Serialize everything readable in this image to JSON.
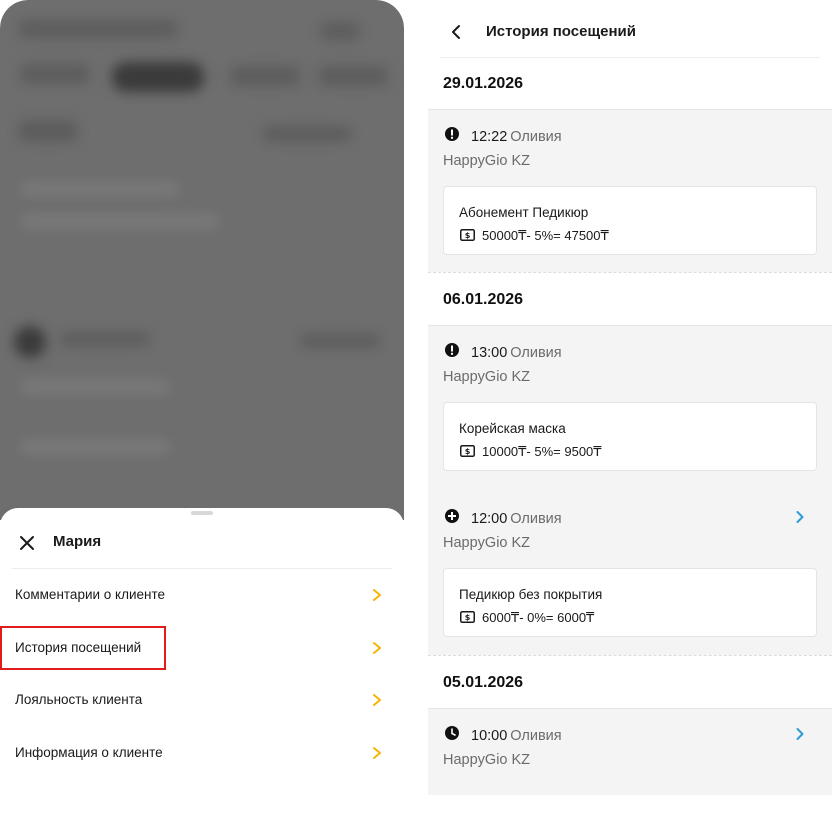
{
  "left": {
    "sheet": {
      "title": "Мария",
      "menu": [
        {
          "label": "Комментарии о клиенте"
        },
        {
          "label": "История посещений"
        },
        {
          "label": "Лояльность клиента"
        },
        {
          "label": "Информация о клиенте"
        }
      ]
    }
  },
  "right": {
    "title": "История посещений",
    "groups": [
      {
        "date": "29.01.2026",
        "visits": [
          {
            "status_icon": "alert-icon",
            "time": "12:22",
            "master": "Оливия",
            "salon": "HappyGio KZ",
            "service": "Абонемент Педикюр",
            "price": "50000₸- 5%= 47500₸"
          }
        ]
      },
      {
        "date": "06.01.2026",
        "visits": [
          {
            "status_icon": "alert-icon",
            "time": "13:00",
            "master": "Оливия",
            "salon": "HappyGio KZ",
            "service": "Корейская маска",
            "price": "10000₸- 5%= 9500₸"
          },
          {
            "status_icon": "plus-circle-icon",
            "time": "12:00",
            "master": "Оливия",
            "salon": "HappyGio KZ",
            "service": "Педикюр без покрытия",
            "price": "6000₸- 0%= 6000₸"
          }
        ]
      },
      {
        "date": "05.01.2026",
        "visits": [
          {
            "status_icon": "clock-icon",
            "time": "10:00",
            "master": "Оливия",
            "salon": "HappyGio KZ"
          }
        ]
      }
    ]
  },
  "colors": {
    "accent_chevron": "#f5b400",
    "link_chevron": "#2f9bd6",
    "highlight_box": "#e01b1b"
  }
}
